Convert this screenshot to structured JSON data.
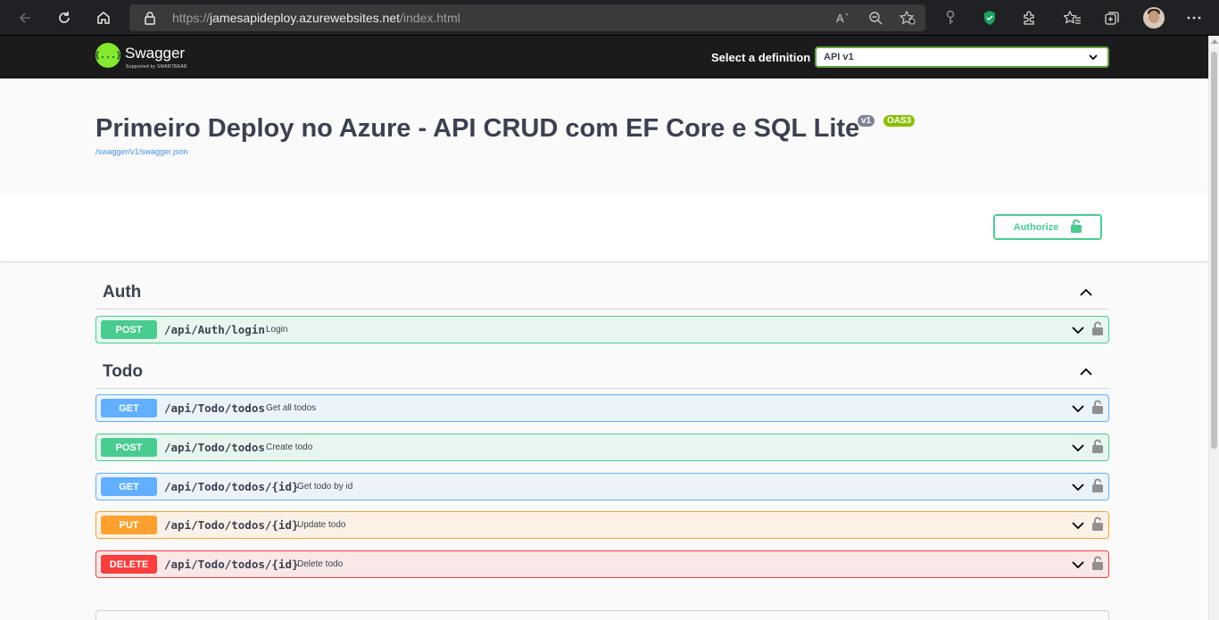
{
  "browser": {
    "url_scheme": "https://",
    "url_host": "jamesapideploy.azurewebsites.net",
    "url_path": "/index.html",
    "icons": [
      "back-icon",
      "refresh-icon",
      "home-icon",
      "lock-icon",
      "read-aloud-icon",
      "zoom-icon",
      "add-favorite-icon",
      "key-icon",
      "shield-icon",
      "extensions-icon",
      "favorites-icon",
      "collections-icon",
      "profile-avatar",
      "more-icon"
    ]
  },
  "topbar": {
    "logo_glyph": "{...}",
    "logo_text": "Swagger",
    "logo_sub": "Supported by SMARTBEAR",
    "definition_label": "Select a definition",
    "definition_value": "API v1"
  },
  "info": {
    "title": "Primeiro Deploy no Azure - API CRUD com EF Core e SQL Lite",
    "version_badge": "v1",
    "oas_badge": "OAS3",
    "spec_link": "/swagger/v1/swagger.json"
  },
  "authorize": {
    "label": "Authorize"
  },
  "tags": [
    {
      "name": "Auth",
      "operations": [
        {
          "method": "POST",
          "path": "/api/Auth/login",
          "summary": "Login"
        }
      ]
    },
    {
      "name": "Todo",
      "operations": [
        {
          "method": "GET",
          "path": "/api/Todo/todos",
          "summary": "Get all todos"
        },
        {
          "method": "POST",
          "path": "/api/Todo/todos",
          "summary": "Create todo"
        },
        {
          "method": "GET",
          "path": "/api/Todo/todos/{id}",
          "summary": "Get todo by id"
        },
        {
          "method": "PUT",
          "path": "/api/Todo/todos/{id}",
          "summary": "Update todo"
        },
        {
          "method": "DELETE",
          "path": "/api/Todo/todos/{id}",
          "summary": "Delete todo"
        }
      ]
    }
  ],
  "colors": {
    "post": "#49cc90",
    "get": "#61affe",
    "put": "#fca130",
    "delete": "#f93e3e",
    "swagger_green": "#85ea2d",
    "topbar": "#1b1b1b"
  }
}
